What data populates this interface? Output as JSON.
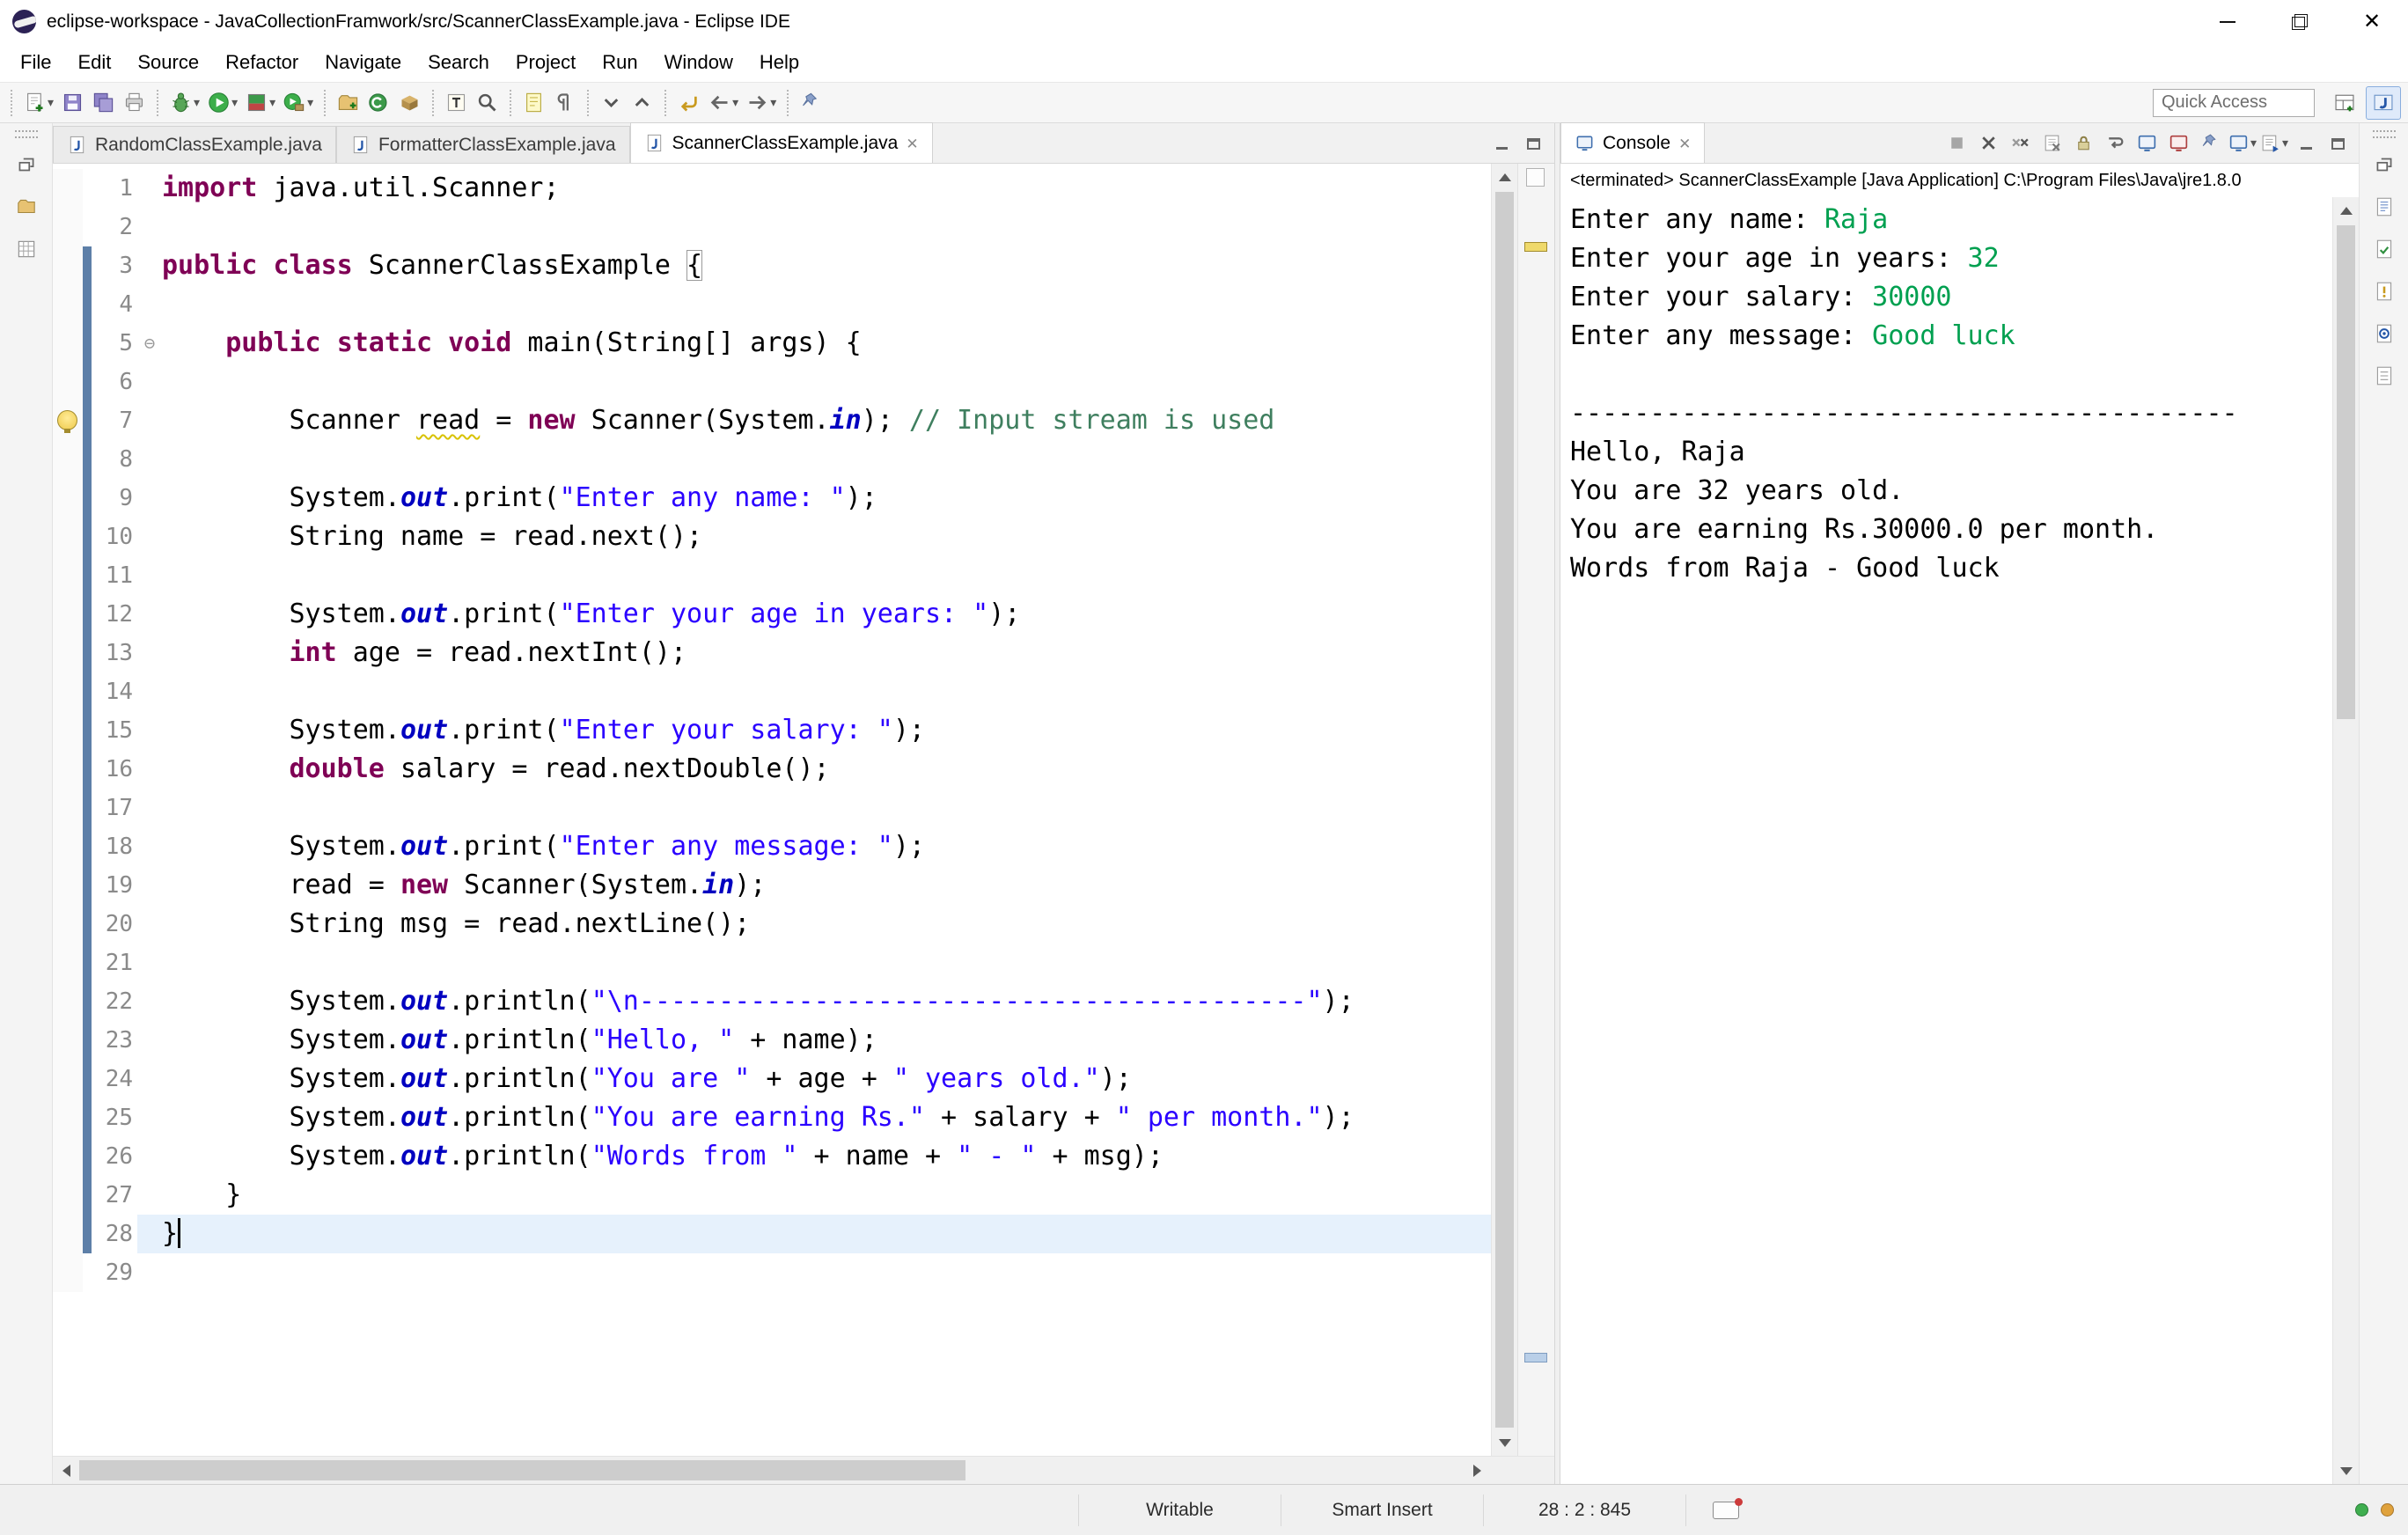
{
  "window": {
    "title": "eclipse-workspace - JavaCollectionFramwork/src/ScannerClassExample.java - Eclipse IDE"
  },
  "menu": {
    "items": [
      "File",
      "Edit",
      "Source",
      "Refactor",
      "Navigate",
      "Search",
      "Project",
      "Run",
      "Window",
      "Help"
    ]
  },
  "toolbar": {
    "quick_access": "Quick Access",
    "groups": [
      [
        {
          "name": "new-wizard",
          "kind": "new",
          "dd": 1
        },
        {
          "name": "save",
          "kind": "floppy"
        },
        {
          "name": "save-all",
          "kind": "floppies"
        },
        {
          "name": "print",
          "kind": "print"
        }
      ],
      [
        {
          "name": "debug",
          "kind": "bug",
          "dd": 1
        },
        {
          "name": "run",
          "kind": "play",
          "dd": 1
        },
        {
          "name": "coverage",
          "kind": "cov",
          "dd": 1
        },
        {
          "name": "run-external-tools",
          "kind": "ext",
          "dd": 1
        }
      ],
      [
        {
          "name": "new-java-project",
          "kind": "newproj"
        },
        {
          "name": "new-java-class",
          "kind": "newclass"
        },
        {
          "name": "new-java-package",
          "kind": "newpkg"
        }
      ],
      [
        {
          "name": "open-type",
          "kind": "opentype"
        },
        {
          "name": "search",
          "kind": "search"
        }
      ],
      [
        {
          "name": "toggle-mark-occurrences",
          "kind": "marker"
        },
        {
          "name": "show-whitespace",
          "kind": "para"
        }
      ],
      [
        {
          "name": "next-annotation",
          "kind": "downc"
        },
        {
          "name": "previous-annotation",
          "kind": "upc"
        }
      ],
      [
        {
          "name": "last-edit-location",
          "kind": "lastedit"
        },
        {
          "name": "back",
          "kind": "back",
          "dd": 1
        },
        {
          "name": "forward",
          "kind": "fwd",
          "dd": 1
        }
      ],
      [
        {
          "name": "pin-editor",
          "kind": "pin"
        }
      ]
    ]
  },
  "perspective_bar": {
    "buttons": [
      {
        "name": "open-perspective",
        "kind": "persp"
      },
      {
        "name": "java-perspective",
        "kind": "jpersp",
        "active": true
      }
    ]
  },
  "left_strip": {
    "icons": [
      {
        "name": "restore-views",
        "kind": "restore"
      },
      {
        "name": "package-explorer-view",
        "kind": "folder"
      },
      {
        "name": "type-hierarchy-view",
        "kind": "grid"
      }
    ]
  },
  "right_strip": {
    "icons": [
      {
        "name": "restore-views",
        "kind": "restore"
      },
      {
        "name": "outline-view",
        "kind": "doc1"
      },
      {
        "name": "task-list-view",
        "kind": "doc2"
      },
      {
        "name": "problems-view",
        "kind": "doc3"
      },
      {
        "name": "javadoc-view",
        "kind": "doc4"
      },
      {
        "name": "declaration-view",
        "kind": "doc5"
      }
    ]
  },
  "editor": {
    "tabs": [
      {
        "label": "RandomClassExample.java",
        "active": false,
        "closable": false
      },
      {
        "label": "FormatterClassExample.java",
        "active": false,
        "closable": false
      },
      {
        "label": "ScannerClassExample.java",
        "active": true,
        "closable": true
      }
    ],
    "lines": [
      {
        "n": 1,
        "toks": [
          [
            "k",
            "import"
          ],
          [
            "p",
            " java.util.Scanner;"
          ]
        ]
      },
      {
        "n": 2,
        "toks": []
      },
      {
        "n": 3,
        "d": 1,
        "toks": [
          [
            "k",
            "public"
          ],
          [
            "p",
            " "
          ],
          [
            "k",
            "class"
          ],
          [
            "p",
            " ScannerClassExample "
          ],
          [
            "b",
            "{"
          ]
        ]
      },
      {
        "n": 4,
        "d": 1,
        "toks": []
      },
      {
        "n": 5,
        "d": 1,
        "fold": 1,
        "toks": [
          [
            "p",
            "    "
          ],
          [
            "k",
            "public"
          ],
          [
            "p",
            " "
          ],
          [
            "k",
            "static"
          ],
          [
            "p",
            " "
          ],
          [
            "k",
            "void"
          ],
          [
            "p",
            " main(String[] args) {"
          ]
        ]
      },
      {
        "n": 6,
        "d": 1,
        "toks": []
      },
      {
        "n": 7,
        "d": 1,
        "warn": 1,
        "toks": [
          [
            "p",
            "        Scanner "
          ],
          [
            "w",
            "read"
          ],
          [
            "p",
            " = "
          ],
          [
            "k",
            "new"
          ],
          [
            "p",
            " Scanner(System."
          ],
          [
            "f",
            "in"
          ],
          [
            "p",
            "); "
          ],
          [
            "c",
            "// Input stream is used"
          ]
        ]
      },
      {
        "n": 8,
        "d": 1,
        "toks": []
      },
      {
        "n": 9,
        "d": 1,
        "toks": [
          [
            "p",
            "        System."
          ],
          [
            "f",
            "out"
          ],
          [
            "p",
            ".print("
          ],
          [
            "s",
            "\"Enter any name: \""
          ],
          [
            "p",
            ");"
          ]
        ]
      },
      {
        "n": 10,
        "d": 1,
        "toks": [
          [
            "p",
            "        String name = read.next();"
          ]
        ]
      },
      {
        "n": 11,
        "d": 1,
        "toks": []
      },
      {
        "n": 12,
        "d": 1,
        "toks": [
          [
            "p",
            "        System."
          ],
          [
            "f",
            "out"
          ],
          [
            "p",
            ".print("
          ],
          [
            "s",
            "\"Enter your age in years: \""
          ],
          [
            "p",
            ");"
          ]
        ]
      },
      {
        "n": 13,
        "d": 1,
        "toks": [
          [
            "p",
            "        "
          ],
          [
            "k",
            "int"
          ],
          [
            "p",
            " age = read.nextInt();"
          ]
        ]
      },
      {
        "n": 14,
        "d": 1,
        "toks": []
      },
      {
        "n": 15,
        "d": 1,
        "toks": [
          [
            "p",
            "        System."
          ],
          [
            "f",
            "out"
          ],
          [
            "p",
            ".print("
          ],
          [
            "s",
            "\"Enter your salary: \""
          ],
          [
            "p",
            ");"
          ]
        ]
      },
      {
        "n": 16,
        "d": 1,
        "toks": [
          [
            "p",
            "        "
          ],
          [
            "k",
            "double"
          ],
          [
            "p",
            " salary = read.nextDouble();"
          ]
        ]
      },
      {
        "n": 17,
        "d": 1,
        "toks": []
      },
      {
        "n": 18,
        "d": 1,
        "toks": [
          [
            "p",
            "        System."
          ],
          [
            "f",
            "out"
          ],
          [
            "p",
            ".print("
          ],
          [
            "s",
            "\"Enter any message: \""
          ],
          [
            "p",
            ");"
          ]
        ]
      },
      {
        "n": 19,
        "d": 1,
        "toks": [
          [
            "p",
            "        read = "
          ],
          [
            "k",
            "new"
          ],
          [
            "p",
            " Scanner(System."
          ],
          [
            "f",
            "in"
          ],
          [
            "p",
            ");"
          ]
        ]
      },
      {
        "n": 20,
        "d": 1,
        "toks": [
          [
            "p",
            "        String msg = read.nextLine();"
          ]
        ]
      },
      {
        "n": 21,
        "d": 1,
        "toks": []
      },
      {
        "n": 22,
        "d": 1,
        "toks": [
          [
            "p",
            "        System."
          ],
          [
            "f",
            "out"
          ],
          [
            "p",
            ".println("
          ],
          [
            "s",
            "\"\\n------------------------------------------\""
          ],
          [
            "p",
            ");"
          ]
        ]
      },
      {
        "n": 23,
        "d": 1,
        "toks": [
          [
            "p",
            "        System."
          ],
          [
            "f",
            "out"
          ],
          [
            "p",
            ".println("
          ],
          [
            "s",
            "\"Hello, \""
          ],
          [
            "p",
            " + name);"
          ]
        ]
      },
      {
        "n": 24,
        "d": 1,
        "toks": [
          [
            "p",
            "        System."
          ],
          [
            "f",
            "out"
          ],
          [
            "p",
            ".println("
          ],
          [
            "s",
            "\"You are \""
          ],
          [
            "p",
            " + age + "
          ],
          [
            "s",
            "\" years old.\""
          ],
          [
            "p",
            ");"
          ]
        ]
      },
      {
        "n": 25,
        "d": 1,
        "toks": [
          [
            "p",
            "        System."
          ],
          [
            "f",
            "out"
          ],
          [
            "p",
            ".println("
          ],
          [
            "s",
            "\"You are earning Rs.\""
          ],
          [
            "p",
            " + salary + "
          ],
          [
            "s",
            "\" per month.\""
          ],
          [
            "p",
            ");"
          ]
        ]
      },
      {
        "n": 26,
        "d": 1,
        "toks": [
          [
            "p",
            "        System."
          ],
          [
            "f",
            "out"
          ],
          [
            "p",
            ".println("
          ],
          [
            "s",
            "\"Words from \""
          ],
          [
            "p",
            " + name + "
          ],
          [
            "s",
            "\" - \""
          ],
          [
            "p",
            " + msg);"
          ]
        ]
      },
      {
        "n": 27,
        "d": 1,
        "toks": [
          [
            "p",
            "    }"
          ]
        ]
      },
      {
        "n": 28,
        "d": 1,
        "cur": 1,
        "toks": [
          [
            "p",
            "}"
          ]
        ]
      },
      {
        "n": 29,
        "toks": []
      }
    ],
    "overview_markers": [
      {
        "type": "warning",
        "top_pct": 4
      },
      {
        "type": "cursorline",
        "top_pct": 90
      }
    ]
  },
  "console": {
    "tab": "Console",
    "terminated": "<terminated> ScannerClassExample [Java Application] C:\\Program Files\\Java\\jre1.8.0",
    "buttons": [
      {
        "name": "terminate",
        "kind": "term"
      },
      {
        "name": "remove-launch",
        "kind": "xblack"
      },
      {
        "name": "remove-all-terminated",
        "kind": "xx"
      },
      {
        "name": "clear-console",
        "kind": "clear"
      },
      {
        "name": "scroll-lock",
        "kind": "lock"
      },
      {
        "name": "word-wrap",
        "kind": "wrap"
      },
      {
        "name": "show-console-on-stdout",
        "kind": "monb"
      },
      {
        "name": "show-console-on-stderr",
        "kind": "monr"
      },
      {
        "name": "pin-console",
        "kind": "pin"
      },
      {
        "name": "display-selected-console",
        "kind": "monb",
        "dd": 1
      },
      {
        "name": "open-console",
        "kind": "opencon",
        "dd": 1
      }
    ],
    "lines": [
      {
        "seg": [
          [
            "o",
            "Enter any name: "
          ],
          [
            "g",
            "Raja"
          ]
        ]
      },
      {
        "seg": [
          [
            "o",
            "Enter your age in years: "
          ],
          [
            "g",
            "32"
          ]
        ]
      },
      {
        "seg": [
          [
            "o",
            "Enter your salary: "
          ],
          [
            "g",
            "30000"
          ]
        ]
      },
      {
        "seg": [
          [
            "o",
            "Enter any message: "
          ],
          [
            "g",
            "Good luck"
          ]
        ]
      },
      {
        "seg": []
      },
      {
        "seg": [
          [
            "o",
            "------------------------------------------"
          ]
        ]
      },
      {
        "seg": [
          [
            "o",
            "Hello, Raja"
          ]
        ]
      },
      {
        "seg": [
          [
            "o",
            "You are 32 years old."
          ]
        ]
      },
      {
        "seg": [
          [
            "o",
            "You are earning Rs.30000.0 per month."
          ]
        ]
      },
      {
        "seg": [
          [
            "o",
            "Words from Raja - Good luck"
          ]
        ]
      }
    ]
  },
  "status": {
    "writable": "Writable",
    "insert_mode": "Smart Insert",
    "position": "28 : 2 : 845"
  },
  "colors": {
    "keyword": "#7f0055",
    "string": "#2a00ff",
    "comment": "#3f7f5f",
    "field": "#0000c0",
    "console_input": "#00a050",
    "console_output": "#000000",
    "current_line_bg": "#e6f1fc",
    "diff_marker": "#5d7fa8",
    "line_number": "#8a8a8a"
  }
}
